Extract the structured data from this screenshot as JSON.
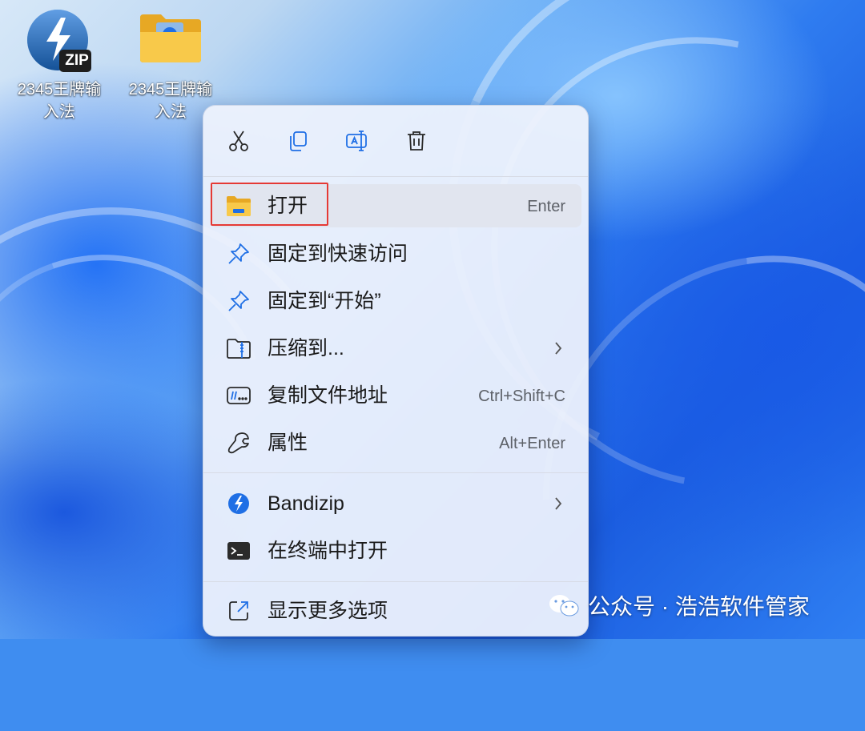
{
  "desktop": {
    "icons": [
      {
        "label": "2345王牌输入法",
        "line1": "2345王牌输",
        "line2": "入法",
        "icon": "zip-archive-icon",
        "badge": "ZIP"
      },
      {
        "label": "2345王牌输入法",
        "line1": "2345王牌输",
        "line2": "入法",
        "icon": "folder-icon"
      }
    ]
  },
  "context_menu": {
    "toolbar": [
      {
        "action": "cut",
        "icon": "scissors-icon"
      },
      {
        "action": "copy",
        "icon": "copy-icon"
      },
      {
        "action": "rename",
        "icon": "rename-icon"
      },
      {
        "action": "delete",
        "icon": "trash-icon"
      }
    ],
    "items": [
      {
        "label": "打开",
        "shortcut": "Enter",
        "icon": "folder-icon",
        "highlighted": true
      },
      {
        "label": "固定到快速访问",
        "icon": "pin-icon"
      },
      {
        "label": "固定到“开始”",
        "icon": "pin-icon"
      },
      {
        "label": "压缩到...",
        "icon": "zip-folder-icon",
        "submenu": true
      },
      {
        "label": "复制文件地址",
        "shortcut": "Ctrl+Shift+C",
        "icon": "copy-path-icon"
      },
      {
        "label": "属性",
        "shortcut": "Alt+Enter",
        "icon": "wrench-icon"
      },
      {
        "label": "Bandizip",
        "icon": "bandizip-icon",
        "submenu": true
      },
      {
        "label": "在终端中打开",
        "icon": "terminal-icon"
      },
      {
        "label": "显示更多选项",
        "icon": "external-link-icon"
      }
    ]
  },
  "watermark": {
    "text": "公众号 · 浩浩软件管家",
    "icon": "wechat-icon"
  },
  "colors": {
    "highlight_border": "#e53935",
    "accent": "#1f6fe5"
  }
}
